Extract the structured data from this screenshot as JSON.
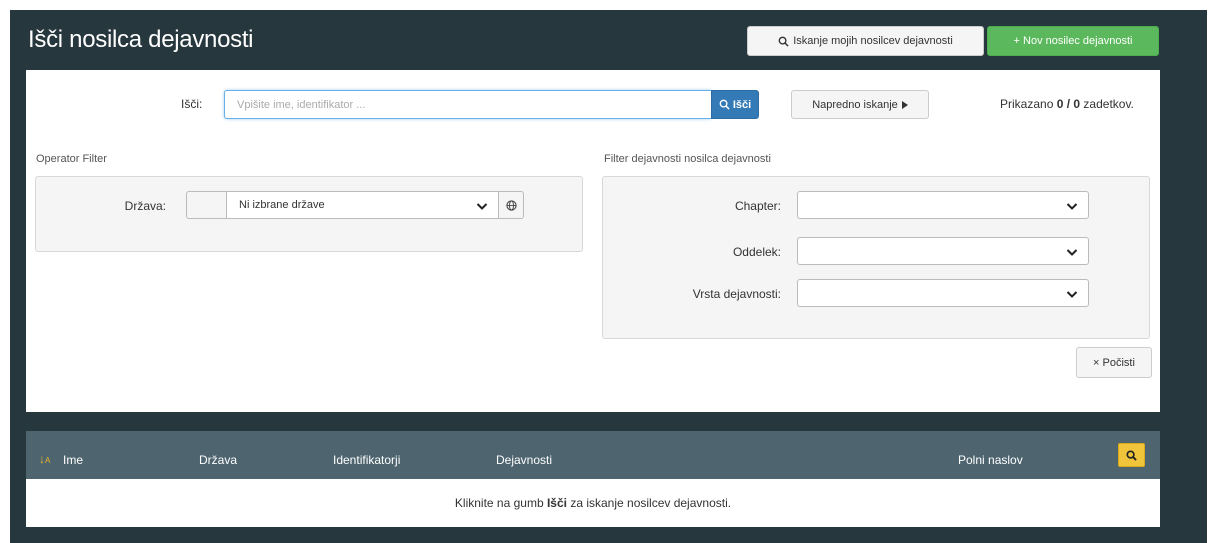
{
  "page": {
    "title": "Išči nosilca dejavnosti",
    "btn_my_search": "Iskanje mojih nosilcev dejavnosti",
    "btn_new": "+ Nov nosilec dejavnosti"
  },
  "search": {
    "label": "Išči:",
    "placeholder": "Vpišite ime, identifikator ...",
    "value": "",
    "button": "Išči",
    "advanced_button": "Napredno iskanje",
    "results_prefix": "Prikazano",
    "results_count": "0 / 0",
    "results_suffix": "zadetkov."
  },
  "operator_filter": {
    "title": "Operator Filter",
    "country_label": "Država:",
    "country_value": "Ni izbrane države"
  },
  "activity_filter": {
    "title": "Filter dejavnosti nosilca dejavnosti",
    "fields": [
      {
        "label": "Chapter:",
        "value": ""
      },
      {
        "label": "Oddelek:",
        "value": ""
      },
      {
        "label": "Vrsta dejavnosti:",
        "value": ""
      }
    ]
  },
  "clear_button": "× Počisti",
  "table": {
    "columns": [
      "Ime",
      "Država",
      "Identifikatorji",
      "Dejavnosti",
      "Polni naslov"
    ],
    "empty_prefix": "Kliknite na gumb",
    "empty_bold": "Išči",
    "empty_suffix": "za iskanje nosilcev dejavnosti."
  },
  "icons": {
    "search": "search-icon",
    "plus": "plus-icon",
    "caret": "caret-right-icon",
    "chevron": "chevron-down-icon",
    "globe": "globe-icon",
    "sort": "sort-alpha-icon"
  },
  "colors": {
    "background": "#27373e",
    "primary": "#337ab7",
    "success": "#5cb85c",
    "table_header": "#4e6570",
    "warning": "#f0c43b"
  }
}
